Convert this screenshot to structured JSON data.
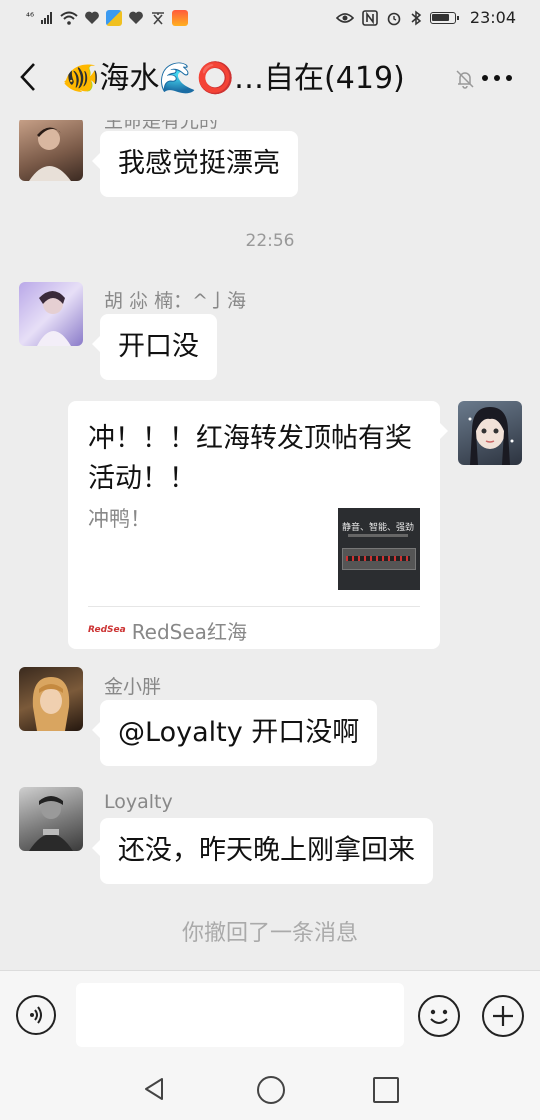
{
  "status_bar": {
    "network": "⁴⁶",
    "time": "23:04"
  },
  "header": {
    "title": "🐠海水🌊⭕…自在(419)",
    "back_icon": "chevron-left-icon",
    "mute_icon": "bell-slash-icon",
    "more_icon": "more-dots-icon"
  },
  "messages": [
    {
      "type": "text",
      "side": "left",
      "sender": "生命是有光的",
      "text": "我感觉挺漂亮"
    },
    {
      "type": "time",
      "text": "22:56"
    },
    {
      "type": "text",
      "side": "left",
      "sender": "胡 尛 楠：^亅海",
      "text": "开口没"
    },
    {
      "type": "link",
      "side": "right",
      "title": "冲！！！红海转发顶帖有奖活动！！",
      "desc": "冲鸭！",
      "thumb_text": "静音、智能、强劲",
      "source_logo": "RedSea",
      "source": "RedSea红海"
    },
    {
      "type": "text",
      "side": "left",
      "sender": "金小胖",
      "text": "@Loyalty  开口没啊"
    },
    {
      "type": "text",
      "side": "left",
      "sender": "Loyalty",
      "text": "还没，昨天晚上刚拿回来"
    },
    {
      "type": "system",
      "text": "你撤回了一条消息"
    }
  ],
  "input_bar": {
    "placeholder": "",
    "voice_icon": "voice-icon",
    "emoji_icon": "emoji-icon",
    "plus_icon": "plus-icon"
  },
  "nav_bar": {
    "back_icon": "nav-back-icon",
    "home_icon": "nav-home-icon",
    "recent_icon": "nav-recent-icon"
  },
  "colors": {
    "background": "#ededed",
    "bubble": "#ffffff",
    "meta_text": "#888888"
  }
}
